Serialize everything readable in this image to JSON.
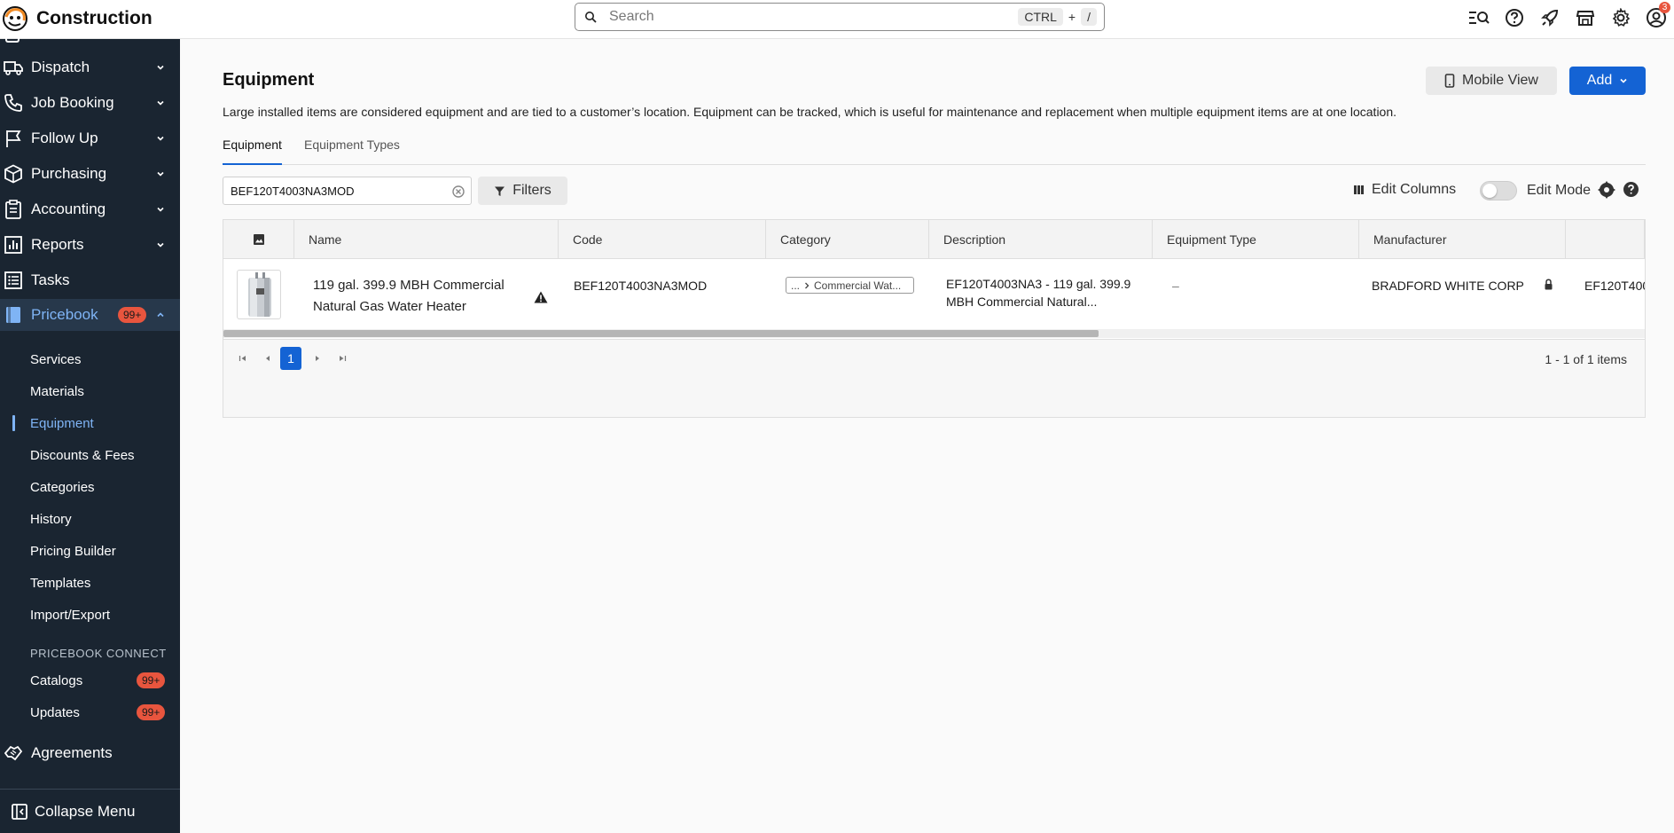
{
  "app": {
    "title": "Construction"
  },
  "search": {
    "placeholder": "Search",
    "shortcut_key1": "CTRL",
    "shortcut_plus": "+",
    "shortcut_key2": "/"
  },
  "header_icons": {
    "notification_count": "3"
  },
  "sidebar": {
    "items": [
      {
        "label": "Dispatch",
        "icon": "truck-icon"
      },
      {
        "label": "Job Booking",
        "icon": "phone-icon"
      },
      {
        "label": "Follow Up",
        "icon": "flag-icon"
      },
      {
        "label": "Purchasing",
        "icon": "box-icon"
      },
      {
        "label": "Accounting",
        "icon": "clipboard-icon"
      },
      {
        "label": "Reports",
        "icon": "chart-icon"
      },
      {
        "label": "Tasks",
        "icon": "list-icon"
      },
      {
        "label": "Pricebook",
        "icon": "book-icon",
        "badge": "99+"
      }
    ],
    "sub_items": [
      {
        "label": "Services"
      },
      {
        "label": "Materials"
      },
      {
        "label": "Equipment"
      },
      {
        "label": "Discounts & Fees"
      },
      {
        "label": "Categories"
      },
      {
        "label": "History"
      },
      {
        "label": "Pricing Builder"
      },
      {
        "label": "Templates"
      },
      {
        "label": "Import/Export"
      }
    ],
    "section_label": "PRICEBOOK CONNECT",
    "connect_items": [
      {
        "label": "Catalogs",
        "badge": "99+"
      },
      {
        "label": "Updates",
        "badge": "99+"
      }
    ],
    "agreements": "Agreements",
    "collapse_label": "Collapse Menu"
  },
  "page": {
    "title": "Equipment",
    "description": "Large installed items are considered equipment and are tied to a customer’s location. Equipment can be tracked, which is useful for maintenance and replacement when multiple equipment items are at one location.",
    "mobile_view_label": "Mobile View",
    "add_label": "Add",
    "tabs": [
      {
        "label": "Equipment"
      },
      {
        "label": "Equipment Types"
      }
    ],
    "filter_value": "BEF120T4003NA3MOD",
    "filters_label": "Filters",
    "edit_columns_label": "Edit Columns",
    "edit_mode_label": "Edit Mode"
  },
  "table": {
    "columns": [
      "Name",
      "Code",
      "Category",
      "Description",
      "Equipment Type",
      "Manufacturer"
    ],
    "rows": [
      {
        "name": "119 gal. 399.9 MBH Commercial Natural Gas Water Heater",
        "code": "BEF120T4003NA3MOD",
        "category_prefix": "...",
        "category": "Commercial Wat...",
        "description": "EF120T4003NA3 - 119 gal. 399.9 MBH Commercial Natural...",
        "equipment_type": "–",
        "manufacturer": "BRADFORD WHITE CORP",
        "extra": "EF120T400"
      }
    ],
    "current_page": "1",
    "page_info": "1 - 1 of 1 items"
  },
  "colors": {
    "sidebar_bg": "#1a2531",
    "accent": "#1463d4",
    "badge": "#e8553e",
    "active_link": "#7fb4f5"
  }
}
